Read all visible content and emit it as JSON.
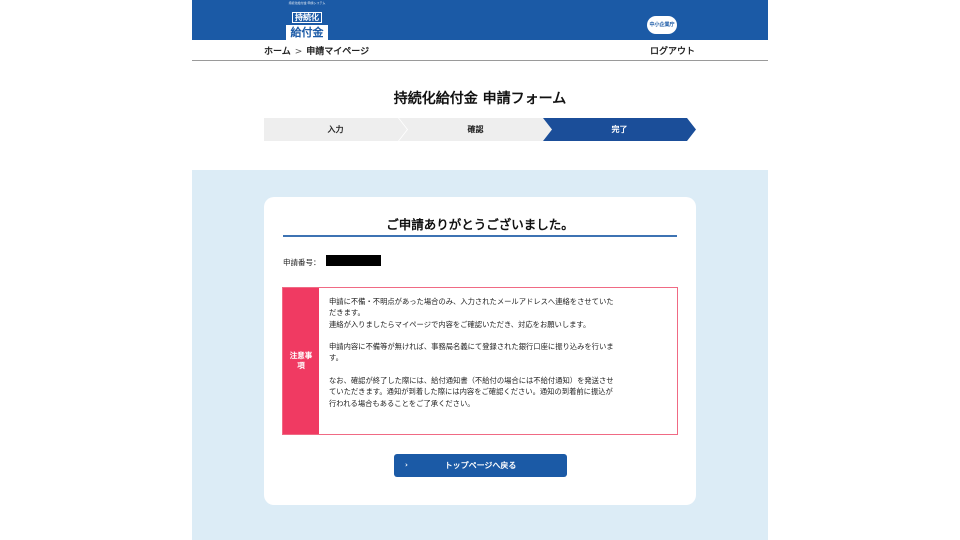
{
  "header": {
    "logo_top_text": "持続化給付金 申請システム",
    "logo_line1": "持続化",
    "logo_line2": "給付金",
    "logo_bottom_text": "JIZOKUKA KYUFUKIN",
    "badge_text": "中小企業庁",
    "brand_color": "#1b5aa6"
  },
  "breadcrumb": {
    "home": "ホーム",
    "separator": ">",
    "current": "申請マイページ",
    "logout": "ログアウト"
  },
  "form_title": "持続化給付金 申請フォーム",
  "steps": [
    {
      "label": "入力",
      "active": false
    },
    {
      "label": "確認",
      "active": false
    },
    {
      "label": "完了",
      "active": true
    }
  ],
  "completion": {
    "heading": "ご申請ありがとうございました。",
    "app_number_label": "申請番号：",
    "app_number_value_redacted": true
  },
  "notice": {
    "label": "注意事項",
    "lines": [
      "申請に不備・不明点があった場合のみ、入力されたメールアドレスへ連絡をさせていた",
      "だきます。",
      "連絡が入りましたらマイページで内容をご確認いただき、対応をお願いします。",
      "",
      "申請内容に不備等が無ければ、事務局名義にて登録された銀行口座に振り込みを行いま",
      "す。",
      "",
      "なお、確認が終了した際には、給付通知書（不給付の場合には不給付通知）を発送させ",
      "ていただきます。通知が到着した際には内容をご確認ください。通知の到着前に振込が",
      "行われる場合もあることをご了承ください。"
    ],
    "accent_color": "#f03a62"
  },
  "back_button": {
    "label": "トップページへ戻る",
    "icon": "chevron-right-icon"
  }
}
